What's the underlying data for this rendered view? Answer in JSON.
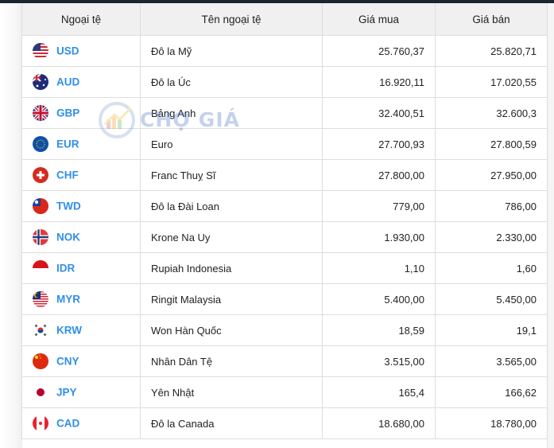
{
  "table": {
    "headers": [
      "Ngoại tệ",
      "Tên ngoại tệ",
      "Giá mua",
      "Giá bán"
    ],
    "rows": [
      {
        "code": "USD",
        "name": "Đô la Mỹ",
        "buy": "25.760,37",
        "sell": "25.820,71",
        "buy_trend": "up",
        "sell_trend": "up",
        "flag": "us-flag-icon"
      },
      {
        "code": "AUD",
        "name": "Đô la Úc",
        "buy": "16.920,11",
        "sell": "17.020,55",
        "buy_trend": "up",
        "sell_trend": "up",
        "flag": "au-flag-icon"
      },
      {
        "code": "GBP",
        "name": "Bảng Anh",
        "buy": "32.400,51",
        "sell": "32.600,3",
        "buy_trend": "up",
        "sell_trend": "up",
        "flag": "gb-flag-icon"
      },
      {
        "code": "EUR",
        "name": "Euro",
        "buy": "27.700,93",
        "sell": "27.800,59",
        "buy_trend": "up",
        "sell_trend": "down",
        "flag": "eu-flag-icon"
      },
      {
        "code": "CHF",
        "name": "Franc Thuỵ Sĩ",
        "buy": "27.800,00",
        "sell": "27.950,00",
        "buy_trend": "up",
        "sell_trend": "up",
        "flag": "ch-flag-icon"
      },
      {
        "code": "TWD",
        "name": "Đô la Đài Loan",
        "buy": "779,00",
        "sell": "786,00",
        "buy_trend": "up",
        "sell_trend": "down",
        "flag": "tw-flag-icon"
      },
      {
        "code": "NOK",
        "name": "Krone Na Uy",
        "buy": "1.930,00",
        "sell": "2.330,00",
        "buy_trend": "down",
        "sell_trend": "down",
        "flag": "no-flag-icon"
      },
      {
        "code": "IDR",
        "name": "Rupiah Indonesia",
        "buy": "1,10",
        "sell": "1,60",
        "buy_trend": "down",
        "sell_trend": "down",
        "flag": "id-flag-icon"
      },
      {
        "code": "MYR",
        "name": "Ringit Malaysia",
        "buy": "5.400,00",
        "sell": "5.450,00",
        "buy_trend": "up",
        "sell_trend": "up",
        "flag": "my-flag-icon"
      },
      {
        "code": "KRW",
        "name": "Won Hàn Quốc",
        "buy": "18,59",
        "sell": "19,1",
        "buy_trend": "up",
        "sell_trend": "up",
        "flag": "kr-flag-icon"
      },
      {
        "code": "CNY",
        "name": "Nhân Dân Tệ",
        "buy": "3.515,00",
        "sell": "3.565,00",
        "buy_trend": "up",
        "sell_trend": "up",
        "flag": "cn-flag-icon"
      },
      {
        "code": "JPY",
        "name": "Yên Nhật",
        "buy": "165,4",
        "sell": "166,62",
        "buy_trend": "up",
        "sell_trend": "up",
        "flag": "jp-flag-icon"
      },
      {
        "code": "CAD",
        "name": "Đô la Canada",
        "buy": "18.680,00",
        "sell": "18.780,00",
        "buy_trend": "up",
        "sell_trend": "up",
        "flag": "ca-flag-icon"
      }
    ]
  },
  "watermark": {
    "text": "CHỢ GIÁ"
  },
  "colors": {
    "up": "#22b573",
    "down": "#e8141e",
    "code": "#2f8fe8"
  }
}
